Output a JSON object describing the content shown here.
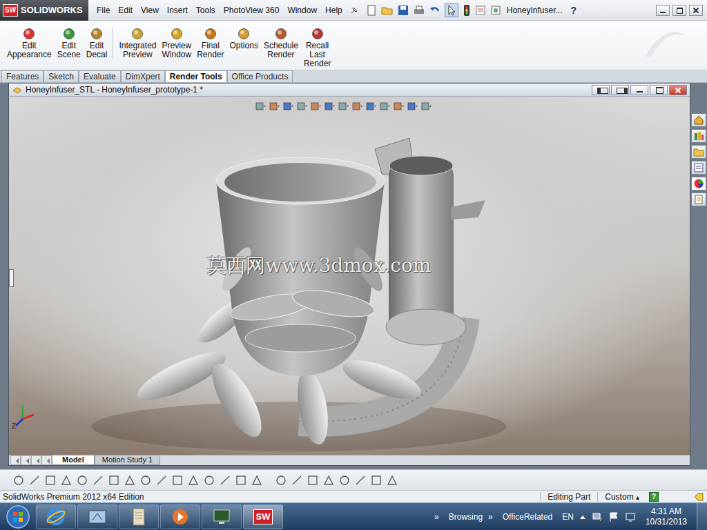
{
  "app": {
    "logo": "SW",
    "brand": "SOLIDWORKS"
  },
  "menu": [
    "File",
    "Edit",
    "View",
    "Insert",
    "Tools",
    "PhotoView 360",
    "Window",
    "Help"
  ],
  "title": "HoneyInfuser...",
  "help": "?",
  "ribbon": [
    {
      "lines": [
        "Edit",
        "Appearance"
      ]
    },
    {
      "lines": [
        "Edit",
        "Scene"
      ]
    },
    {
      "lines": [
        "Edit",
        "Decal"
      ]
    },
    {
      "lines": [
        "Integrated",
        "Preview"
      ]
    },
    {
      "lines": [
        "Preview",
        "Window"
      ]
    },
    {
      "lines": [
        "Final",
        "Render"
      ]
    },
    {
      "lines": [
        "Options"
      ]
    },
    {
      "lines": [
        "Schedule",
        "Render"
      ]
    },
    {
      "lines": [
        "Recall",
        "Last",
        "Render"
      ]
    }
  ],
  "tabs": [
    {
      "label": "Features",
      "selected": false
    },
    {
      "label": "Sketch",
      "selected": false
    },
    {
      "label": "Evaluate",
      "selected": false
    },
    {
      "label": "DimXpert",
      "selected": false
    },
    {
      "label": "Render Tools",
      "selected": true
    },
    {
      "label": "Office Products",
      "selected": false
    }
  ],
  "document": {
    "title": "HoneyInfuser_STL - HoneyInfuser_prototype-1 *",
    "watermark": "莫西网www.3dmox.com",
    "axis": "Z"
  },
  "bottom_tabs": [
    {
      "label": "Model",
      "selected": true
    },
    {
      "label": "Motion Study 1",
      "selected": false
    }
  ],
  "status_bar": {
    "edition": "SolidWorks Premium 2012 x64 Edition",
    "mode": "Editing Part",
    "units": "Custom",
    "units_arrow": "▴",
    "help": "?"
  },
  "taskbar": {
    "toolbars": [
      {
        "label": "Browsing",
        "chevron": "»"
      },
      {
        "label": "OfficeRelated",
        "chevron": "»"
      }
    ],
    "language": "EN",
    "time": "4:31 AM",
    "date": "10/31/2013"
  }
}
